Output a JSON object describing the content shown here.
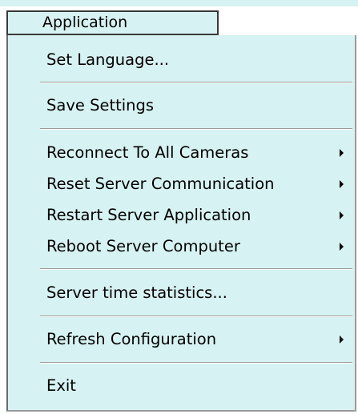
{
  "menu": {
    "title": "Application",
    "items": {
      "set_language": {
        "label": "Set Language...",
        "has_submenu": false
      },
      "save_settings": {
        "label": "Save Settings",
        "has_submenu": false
      },
      "reconnect": {
        "label": "Reconnect To All Cameras",
        "has_submenu": true
      },
      "reset_comm": {
        "label": "Reset Server Communication",
        "has_submenu": true
      },
      "restart_app": {
        "label": "Restart Server Application",
        "has_submenu": true
      },
      "reboot": {
        "label": "Reboot Server Computer",
        "has_submenu": true
      },
      "time_stats": {
        "label": "Server time statistics...",
        "has_submenu": false
      },
      "refresh": {
        "label": "Refresh Configuration",
        "has_submenu": true
      },
      "exit": {
        "label": "Exit",
        "has_submenu": false
      }
    }
  },
  "colors": {
    "menu_background": "#d7f2f2",
    "text": "#000000",
    "border": "#3a3a3a"
  },
  "icons": {
    "submenu_arrow": "triangle-right"
  }
}
